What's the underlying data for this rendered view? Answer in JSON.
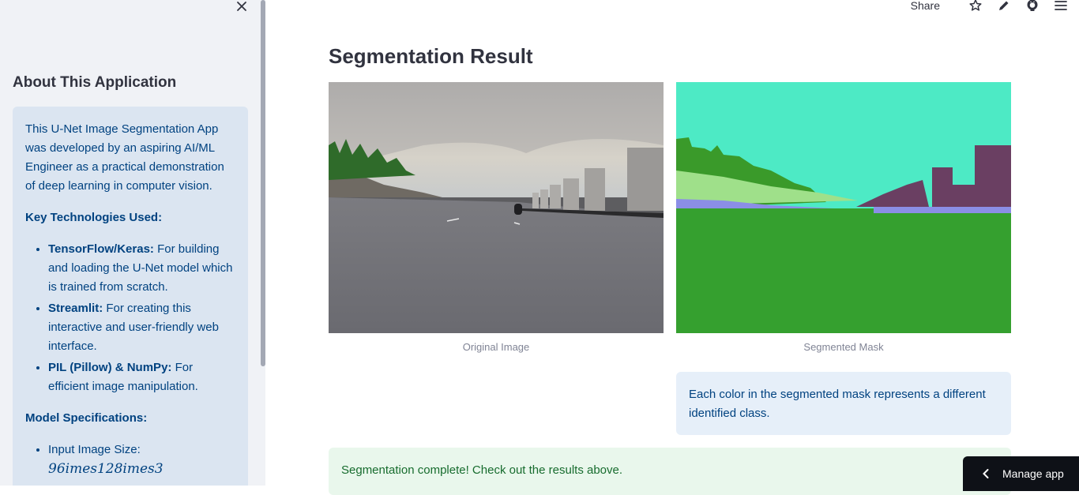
{
  "sidebar": {
    "heading": "About This Application",
    "intro": "This U-Net Image Segmentation App was developed by an aspiring AI/ML Engineer as a practical demonstration of deep learning in computer vision.",
    "tech_heading": "Key Technologies Used:",
    "technologies": [
      {
        "name": "TensorFlow/Keras:",
        "desc": " For building and loading the U-Net model which is trained from scratch."
      },
      {
        "name": "Streamlit:",
        "desc": " For creating this interactive and user-friendly web interface."
      },
      {
        "name": "PIL (Pillow) & NumPy:",
        "desc": " For efficient image manipulation."
      }
    ],
    "spec_heading": "Model Specifications:",
    "specs": [
      {
        "label": "Input Image Size:",
        "value": "96imes128imes3"
      }
    ]
  },
  "toolbar": {
    "share_label": "Share",
    "icons": [
      "star-icon",
      "edit-icon",
      "github-icon",
      "menu-icon"
    ]
  },
  "main": {
    "title": "Segmentation Result",
    "original_caption": "Original Image",
    "mask_caption": "Segmented Mask",
    "mask_info": "Each color in the segmented mask represents a different identified class.",
    "success_message": "Segmentation complete! Check out the results above."
  },
  "manage_app": {
    "label": "Manage app"
  },
  "colors": {
    "sidebar_bg": "#f0f2f6",
    "info_bg": "#dbe5f1",
    "info_text": "#004280",
    "success_bg": "#e9f7ec",
    "success_text": "#176c2e",
    "mask_sky": "#4deac5",
    "mask_road": "#35a02f",
    "mask_building": "#6a3f62",
    "mask_vegetation": "#3a9a2a",
    "mask_sidewalk": "#8b8ee6"
  }
}
